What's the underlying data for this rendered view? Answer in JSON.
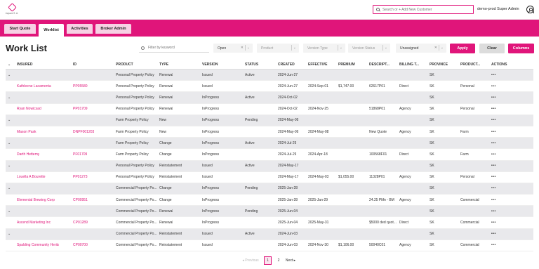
{
  "header": {
    "logo_text": "inqsure S. A.",
    "search_placeholder": "Search or + Add New Customer",
    "user_name": "demo-prod Super Admin"
  },
  "tabs": [
    {
      "label": "Start Quote",
      "active": false
    },
    {
      "label": "Worklist",
      "active": true
    },
    {
      "label": "Activities",
      "active": false
    },
    {
      "label": "Broker Admin",
      "active": false
    }
  ],
  "page_title": "Work List",
  "filters": {
    "keyword_placeholder": "Filter by keyword",
    "status_value": "Open",
    "product_placeholder": "Product",
    "version_type_placeholder": "Version Type",
    "version_status_placeholder": "Version Status",
    "assigned_value": "Unassigned",
    "apply_label": "Apply",
    "clear_label": "Clear",
    "columns_label": "Columns"
  },
  "columns": [
    "INSURED",
    "ID",
    "PRODUCT",
    "TYPE",
    "VERSION",
    "STATUS",
    "CREATED",
    "EFFECTIVE",
    "PREMIUM",
    "DESCRIPT...",
    "BILLING T...",
    "PROVINCE",
    "PRODUCT...",
    "ACTIONS"
  ],
  "rows": [
    {
      "sub": true,
      "product": "Personal Property Policy",
      "type": "Renewal",
      "version": "Issued",
      "status": "Active",
      "created": "2024-Jun-27",
      "effective": "",
      "premium": "",
      "desc": "",
      "billing": "",
      "province": "SK",
      "product2": "",
      "actions": "•••"
    },
    {
      "sub": false,
      "insured": "Kathleene Lacamenta",
      "id": "PP05580",
      "product": "Personal Property Policy",
      "type": "Renewal",
      "version": "Issued",
      "status": "",
      "created": "2024-Jun-27",
      "effective": "2024-Sep-01",
      "premium": "$1,747.00",
      "desc": "62617P01",
      "billing": "Direct",
      "province": "SK",
      "product2": "Personal",
      "actions": "•••"
    },
    {
      "sub": true,
      "product": "Personal Property Policy",
      "type": "Renewal",
      "version": "InProgress",
      "status": "Active",
      "created": "2024-Oct-02",
      "effective": "",
      "premium": "",
      "desc": "",
      "billing": "",
      "province": "SK",
      "product2": "",
      "actions": "•••"
    },
    {
      "sub": false,
      "insured": "Ryan Nowicsad",
      "id": "PP01709",
      "product": "Personal Property Policy",
      "type": "Renewal",
      "version": "InProgress",
      "status": "",
      "created": "2024-Oct-02",
      "effective": "2024-Nov-25",
      "premium": "",
      "desc": "51868P01",
      "billing": "Agency",
      "province": "SK",
      "product2": "Personal",
      "actions": "•••"
    },
    {
      "sub": true,
      "product": "Farm Property Policy",
      "type": "New",
      "version": "InProgress",
      "status": "Pending",
      "created": "2024-May-09",
      "effective": "",
      "premium": "",
      "desc": "",
      "billing": "",
      "province": "SK",
      "product2": "",
      "actions": "•••"
    },
    {
      "sub": false,
      "insured": "Mason Pask",
      "id": "DNPF001203",
      "product": "Farm Property Policy",
      "type": "New",
      "version": "InProgress",
      "status": "",
      "created": "2024-May-09",
      "effective": "2024-May-08",
      "premium": "",
      "desc": "New Quote",
      "billing": "Agency",
      "province": "SK",
      "product2": "Farm",
      "actions": "•••"
    },
    {
      "sub": true,
      "product": "Farm Property Policy",
      "type": "Change",
      "version": "InProgress",
      "status": "Active",
      "created": "2024-Jul-29",
      "effective": "",
      "premium": "",
      "desc": "",
      "billing": "",
      "province": "SK",
      "product2": "",
      "actions": "•••"
    },
    {
      "sub": false,
      "insured": "Darth Hettemy",
      "id": "PF01709",
      "product": "Farm Property Policy",
      "type": "Change",
      "version": "InProgress",
      "status": "",
      "created": "2024-Jul-29",
      "effective": "2024-Apr-18",
      "premium": "",
      "desc": "100568F01",
      "billing": "Direct",
      "province": "SK",
      "product2": "Farm",
      "actions": "•••"
    },
    {
      "sub": true,
      "product": "Personal Property Policy",
      "type": "Reinstatement",
      "version": "Issued",
      "status": "Active",
      "created": "2024-May-17",
      "effective": "",
      "premium": "",
      "desc": "",
      "billing": "",
      "province": "SK",
      "product2": "",
      "actions": "•••"
    },
    {
      "sub": false,
      "insured": "Louella A Bourette",
      "id": "PP01273",
      "product": "Personal Property Policy",
      "type": "Reinstatement",
      "version": "Issued",
      "status": "",
      "created": "2024-May-17",
      "effective": "2024-May-03",
      "premium": "$1,055.00",
      "desc": "11328P01",
      "billing": "Agency",
      "province": "SK",
      "product2": "Personal",
      "actions": "•••"
    },
    {
      "sub": true,
      "product": "Commercial Property Po...",
      "type": "Change",
      "version": "InProgress",
      "status": "Pending",
      "created": "2025-Jan-28",
      "effective": "",
      "premium": "",
      "desc": "",
      "billing": "",
      "province": "SK",
      "product2": "",
      "actions": "•••"
    },
    {
      "sub": false,
      "insured": "Elemental Brewing Corp",
      "id": "CP00951",
      "product": "Commercial Property Po...",
      "type": "Change",
      "version": "InProgress",
      "status": "",
      "created": "2025-Jan-28",
      "effective": "2025-Jan-29",
      "premium": "",
      "desc": "24.25 Pltfn - BM",
      "billing": "Agency",
      "province": "SK",
      "product2": "Commercial",
      "actions": "•••"
    },
    {
      "sub": true,
      "product": "Commercial Property Po...",
      "type": "Renewal",
      "version": "InProgress",
      "status": "Pending",
      "created": "2025-Jun-04",
      "effective": "",
      "premium": "",
      "desc": "",
      "billing": "",
      "province": "SK",
      "product2": "",
      "actions": "•••"
    },
    {
      "sub": false,
      "insured": "Ascend Marketing Inc",
      "id": "CP01289",
      "product": "Commercial Property Po...",
      "type": "Renewal",
      "version": "InProgress",
      "status": "",
      "created": "2025-Jun-04",
      "effective": "2025-May-31",
      "premium": "",
      "desc": "$5000 ded quot...",
      "billing": "Direct",
      "province": "SK",
      "product2": "Commercial",
      "actions": "•••"
    },
    {
      "sub": true,
      "product": "Commercial Property Po...",
      "type": "Reinstatement",
      "version": "Issued",
      "status": "Active",
      "created": "2024-Jun-03",
      "effective": "",
      "premium": "",
      "desc": "",
      "billing": "",
      "province": "SK",
      "product2": "",
      "actions": "•••"
    },
    {
      "sub": false,
      "insured": "Spalding Community Heritage C...",
      "id": "CP00700",
      "product": "Commercial Property Po...",
      "type": "Reinstatement",
      "version": "Issued",
      "status": "",
      "created": "2024-Jun-03",
      "effective": "2024-Nov-30",
      "premium": "$1,106.00",
      "desc": "50040C01",
      "billing": "Agency",
      "province": "SK",
      "product2": "Commercial",
      "actions": "•••"
    }
  ],
  "pager": {
    "previous": "Previous",
    "page1": "1",
    "page2": "2",
    "next": "Next"
  }
}
